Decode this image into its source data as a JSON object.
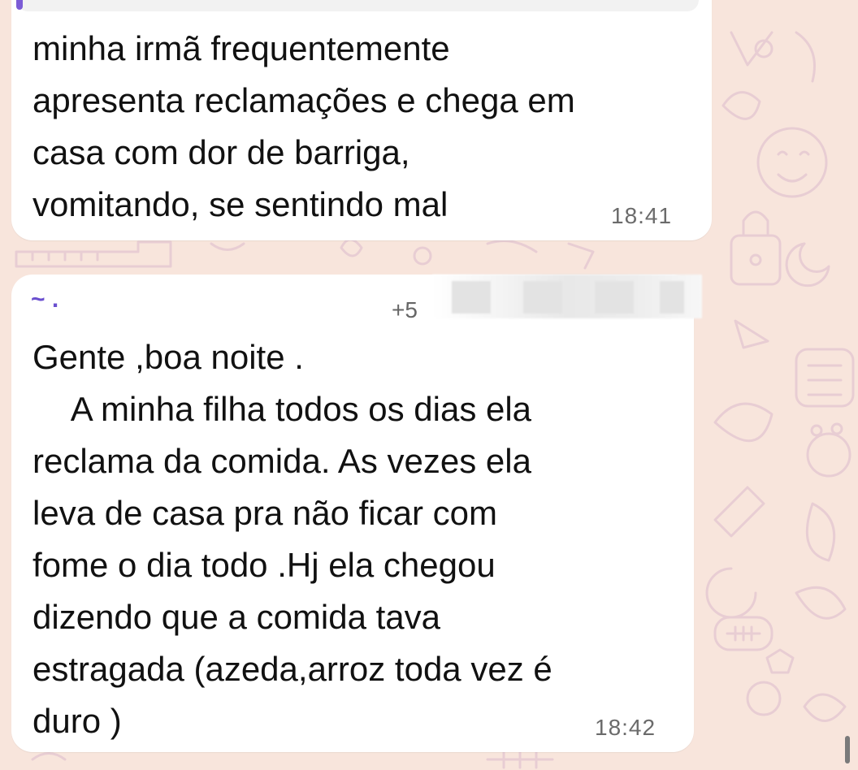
{
  "theme": {
    "wallpaper_color": "#f8e5dc",
    "doodle_color": "#e8cdd3",
    "bubble_color": "#ffffff",
    "sender_color": "#6a4fcf",
    "accent_bar_color": "#7c5cd6"
  },
  "messages": [
    {
      "text": "minha irmã frequentemente\napresenta reclamações e chega em\ncasa com dor de barriga,\nvomitando, se sentindo mal",
      "time": "18:41"
    },
    {
      "sender": "~ .",
      "phone": "+5",
      "text": "Gente ,boa noite .\n    A minha filha todos os dias ela\nreclama da comida. As vezes ela\nleva de casa pra não ficar com\nfome o dia todo .Hj ela chegou\ndizendo que a comida tava\nestragada (azeda,arroz toda vez é\nduro )",
      "time": "18:42"
    }
  ]
}
